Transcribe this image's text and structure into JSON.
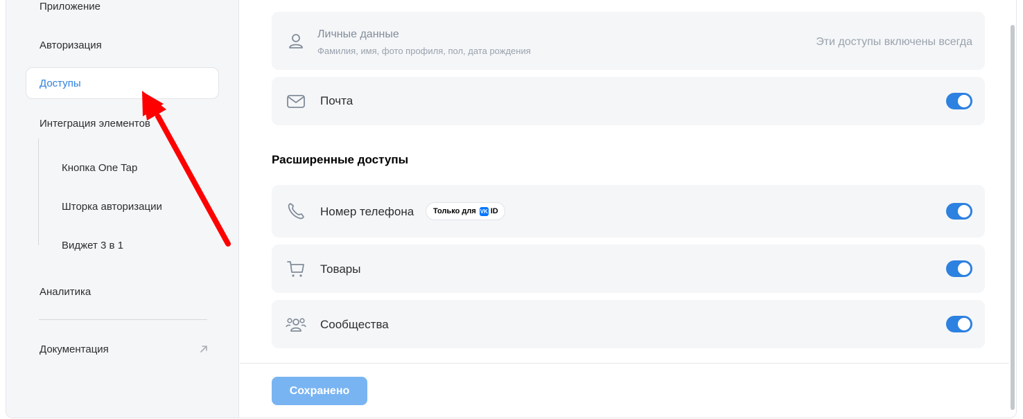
{
  "sidebar": {
    "items": [
      {
        "label": "Приложение"
      },
      {
        "label": "Авторизация"
      },
      {
        "label": "Доступы"
      },
      {
        "label": "Интеграция элементов"
      }
    ],
    "sub_items": [
      {
        "label": "Кнопка One Tap"
      },
      {
        "label": "Шторка авторизации"
      },
      {
        "label": "Виджет 3 в 1"
      }
    ],
    "analytics": {
      "label": "Аналитика"
    },
    "docs": {
      "label": "Документация",
      "icon": "external-link-icon"
    }
  },
  "main": {
    "personal": {
      "title": "Личные данные",
      "subtitle": "Фамилия, имя, фото профиля, пол, дата рождения",
      "always_on": "Эти доступы включены всегда",
      "icon": "user-icon"
    },
    "mail": {
      "label": "Почта",
      "icon": "mail-icon",
      "enabled": true
    },
    "extended_title": "Расширенные доступы",
    "phone": {
      "label": "Номер телефона",
      "icon": "phone-icon",
      "enabled": true,
      "badge": {
        "text": "Только для",
        "logo": "VK",
        "suffix": "ID"
      }
    },
    "goods": {
      "label": "Товары",
      "icon": "cart-icon",
      "enabled": true
    },
    "communities": {
      "label": "Сообщества",
      "icon": "users-group-icon",
      "enabled": true
    },
    "save_label": "Сохранено"
  },
  "colors": {
    "accent": "#2d81e0",
    "save_button": "#79b4f2",
    "card_bg": "#f5f6f8",
    "arrow": "#ff0000"
  }
}
